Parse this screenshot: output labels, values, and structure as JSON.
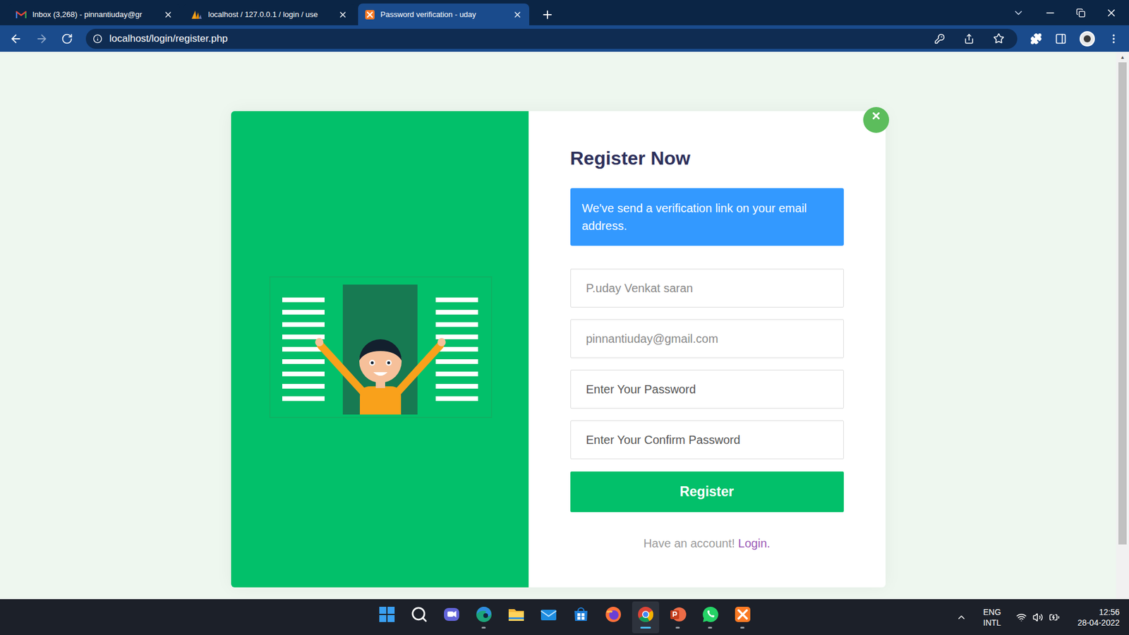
{
  "browser": {
    "tabs": [
      {
        "label": "Inbox (3,268) - pinnantiuday@gr",
        "kind": "gmail",
        "selected": false
      },
      {
        "label": "localhost / 127.0.0.1 / login / use",
        "kind": "phpmyadmin",
        "selected": false
      },
      {
        "label": "Password verification - uday",
        "kind": "xampp",
        "selected": true
      }
    ],
    "address": "localhost/login/register.php",
    "bookmarked": false
  },
  "form": {
    "title": "Register Now",
    "alert": "We've send a verification link on your email address.",
    "fields": [
      {
        "text": "P.uday Venkat saran",
        "kind": "value"
      },
      {
        "text": "pinnantiuday@gmail.com",
        "kind": "value"
      },
      {
        "text": "Enter Your Password",
        "kind": "placeholder"
      },
      {
        "text": "Enter Your Confirm Password",
        "kind": "placeholder"
      }
    ],
    "submit": "Register",
    "footer": {
      "text": "Have an account!",
      "link": "Login."
    }
  },
  "taskbar": {
    "apps": [
      {
        "kind": "windows",
        "running": false,
        "active": false
      },
      {
        "kind": "search",
        "running": false,
        "active": false
      },
      {
        "kind": "teams",
        "running": false,
        "active": false
      },
      {
        "kind": "edge",
        "running": true,
        "active": false
      },
      {
        "kind": "explorer",
        "running": false,
        "active": false
      },
      {
        "kind": "mail",
        "running": false,
        "active": false
      },
      {
        "kind": "store",
        "running": false,
        "active": false
      },
      {
        "kind": "firefox",
        "running": false,
        "active": false
      },
      {
        "kind": "chrome",
        "running": true,
        "active": true
      },
      {
        "kind": "powerpoint",
        "running": true,
        "active": false
      },
      {
        "kind": "whatsapp",
        "running": true,
        "active": false
      },
      {
        "kind": "xampp",
        "running": true,
        "active": false
      }
    ],
    "language": "ENG",
    "layout": "INTL",
    "time": "12:56",
    "date": "28-04-2022"
  }
}
